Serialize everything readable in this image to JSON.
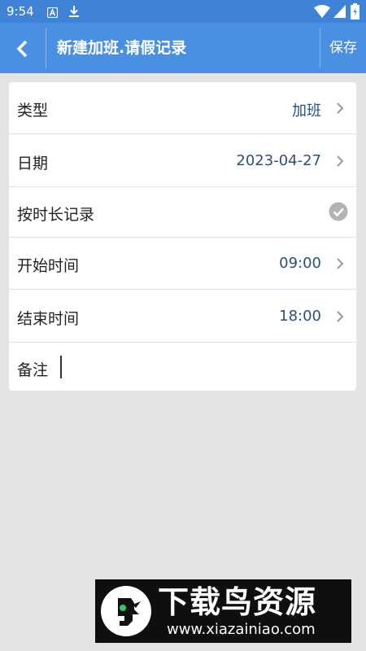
{
  "status_bar": {
    "time": "9:54",
    "icons": [
      "app-a-icon",
      "download-icon",
      "wifi-icon",
      "cell-signal-icon",
      "battery-icon"
    ]
  },
  "header": {
    "back_icon": "chevron-left-icon",
    "title": "新建加班.请假记录",
    "save_label": "保存"
  },
  "form": {
    "type": {
      "label": "类型",
      "value": "加班"
    },
    "date": {
      "label": "日期",
      "value": "2023-04-27"
    },
    "by_duration": {
      "label": "按时长记录",
      "checked": true
    },
    "start_time": {
      "label": "开始时间",
      "value": "09:00"
    },
    "end_time": {
      "label": "结束时间",
      "value": "18:00"
    },
    "note": {
      "label": "备注",
      "value": ""
    }
  },
  "watermark": {
    "title": "下载鸟资源",
    "url": "www.xiazainiao.com"
  },
  "colors": {
    "appbar": "#4a90e2",
    "statusbar": "#3f83d8",
    "background": "#e4e4e4",
    "value_text": "#2b4f7e",
    "check_gray": "#b4b4b4"
  }
}
